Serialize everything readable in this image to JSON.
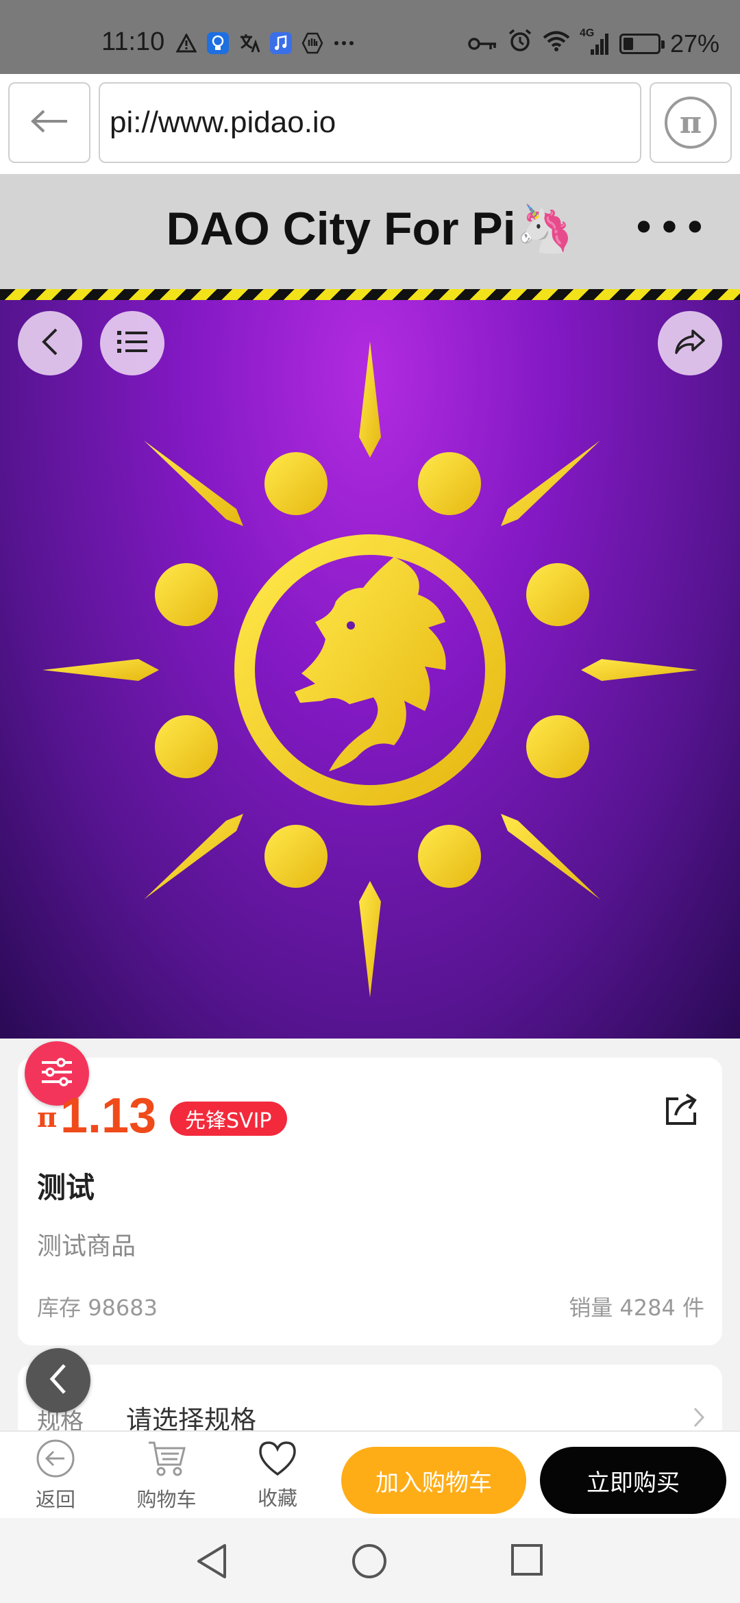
{
  "status_bar": {
    "time": "11:10",
    "battery": "27%",
    "network": "4G",
    "icons": [
      "warning-icon",
      "lightbulb-icon",
      "translate-icon",
      "music-icon",
      "hand-icon",
      "more-dots-icon",
      "key-icon",
      "alarm-icon",
      "wifi-icon",
      "signal-icon",
      "battery-icon"
    ]
  },
  "browser": {
    "url": "pi://www.pidao.io",
    "back_icon": "arrow-left-icon",
    "pi_icon": "pi-logo-icon",
    "pi_symbol": "π"
  },
  "header": {
    "title": "DAO City For Pi🦄",
    "more": "•••"
  },
  "hero": {
    "icons": [
      "chevron-left-icon",
      "list-icon",
      "share-icon"
    ],
    "image": "golden-sun-dragon-logo"
  },
  "product": {
    "currency_symbol": "π",
    "price": "1.13",
    "badge": "先锋SVIP",
    "name": "测试",
    "description": "测试商品",
    "stock_label": "库存",
    "stock": "98683",
    "sales_label": "销量",
    "sales": "4284",
    "sales_unit": "件"
  },
  "spec": {
    "label": "规格",
    "value": "请选择规格"
  },
  "action_bar": {
    "back": "返回",
    "cart": "购物车",
    "favorite": "收藏",
    "add_to_cart": "加入购物车",
    "buy_now": "立即购买"
  },
  "colors": {
    "accent_price": "#f04a1a",
    "badge": "#f22a3c",
    "add_to_cart": "#ffad17",
    "buy_now": "#050505",
    "hero_purple": "#8319c4",
    "logo_gold": "#f5d21f"
  }
}
